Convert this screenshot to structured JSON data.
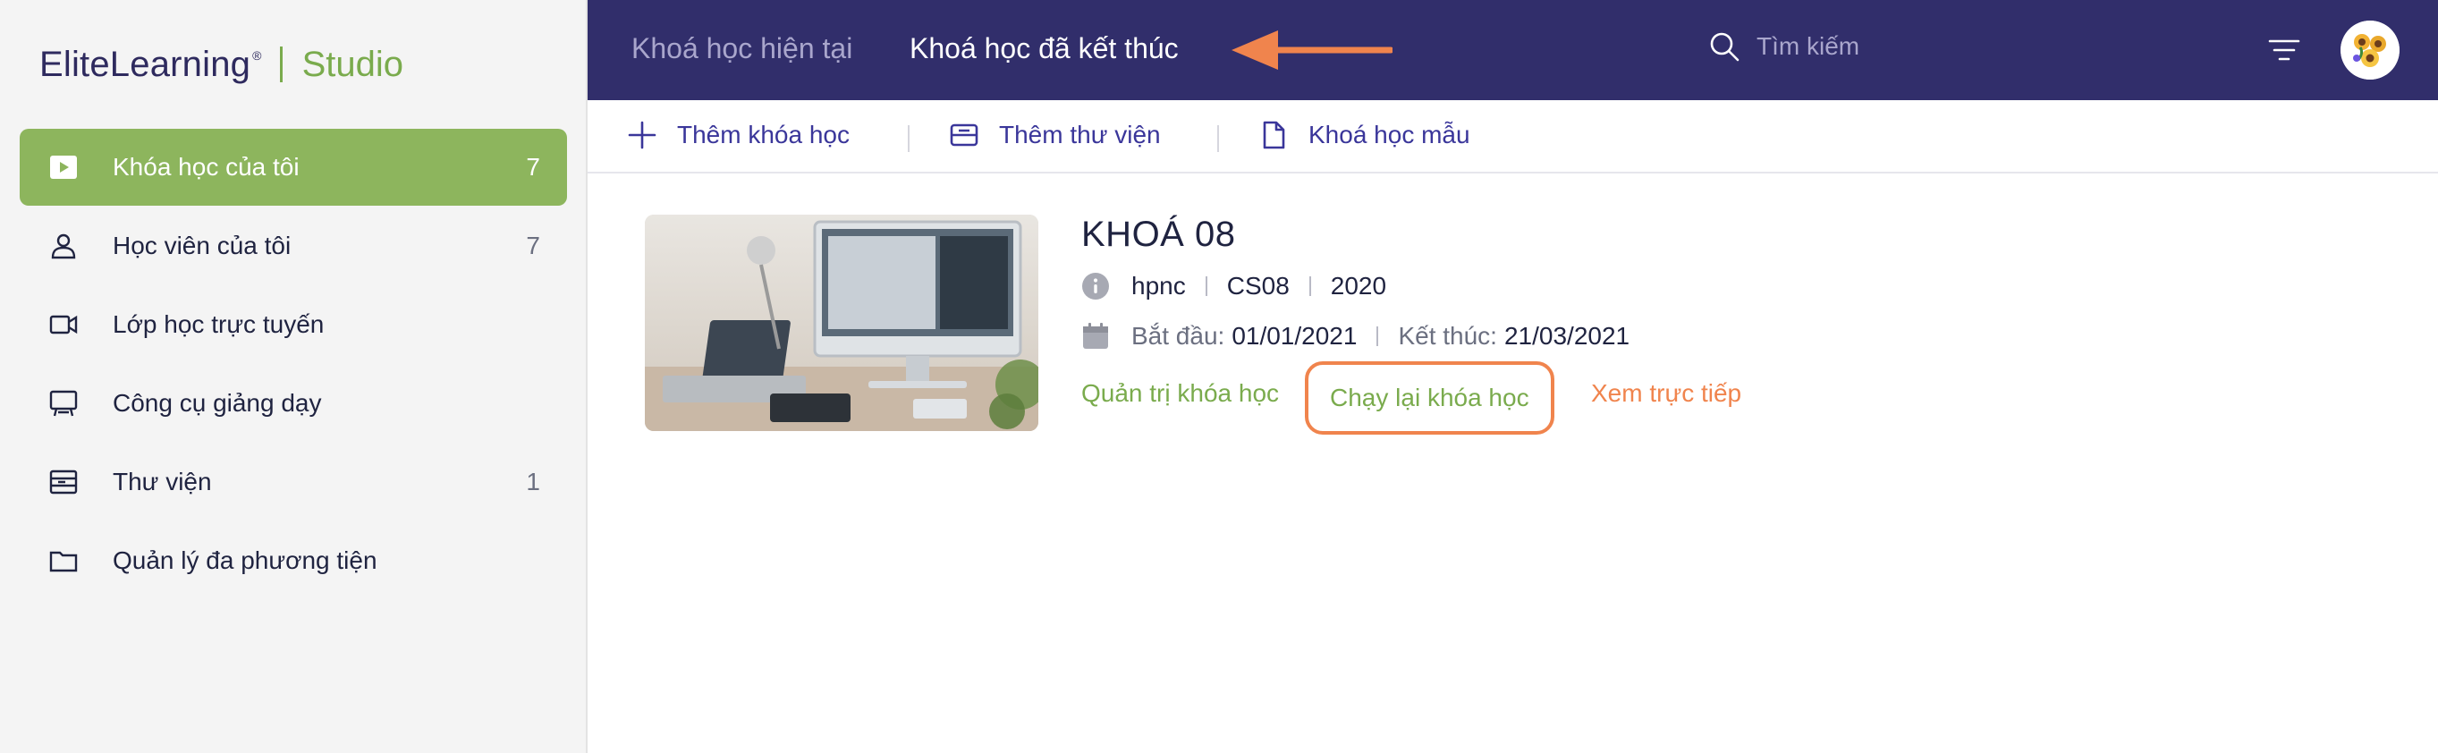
{
  "brand": {
    "name": "EliteLearning",
    "studio": "Studio"
  },
  "sidebar": {
    "items": [
      {
        "label": "Khóa học của tôi",
        "count": "7",
        "icon": "play-icon",
        "active": true
      },
      {
        "label": "Học viên của tôi",
        "count": "7",
        "icon": "user-icon"
      },
      {
        "label": "Lớp học trực tuyến",
        "count": "",
        "icon": "video-icon"
      },
      {
        "label": "Công cụ giảng dạy",
        "count": "",
        "icon": "presentation-icon"
      },
      {
        "label": "Thư viện",
        "count": "1",
        "icon": "library-icon"
      },
      {
        "label": "Quản lý đa phương tiện",
        "count": "",
        "icon": "folder-icon"
      }
    ]
  },
  "header": {
    "tabs": [
      {
        "label": "Khoá học hiện tại"
      },
      {
        "label": "Khoá học đã kết thúc",
        "active": true
      }
    ],
    "search_placeholder": "Tìm kiếm"
  },
  "toolbar": {
    "add_course": "Thêm khóa học",
    "add_library": "Thêm thư viện",
    "template_course": "Khoá học mẫu"
  },
  "course": {
    "title": "KHOÁ 08",
    "author": "hpnc",
    "code": "CS08",
    "year": "2020",
    "start_label": "Bắt đầu:",
    "start_date": "01/01/2021",
    "end_label": "Kết thúc:",
    "end_date": "21/03/2021",
    "actions": {
      "admin": "Quản trị khóa học",
      "rerun": "Chạy lại khóa học",
      "live": "Xem trực tiếp"
    }
  },
  "colors": {
    "sidebar_active": "#8db55d",
    "topbar": "#312e6b",
    "accent_orange": "#f0844d",
    "accent_green": "#7aab4d",
    "toolbar_text": "#3a369a"
  }
}
